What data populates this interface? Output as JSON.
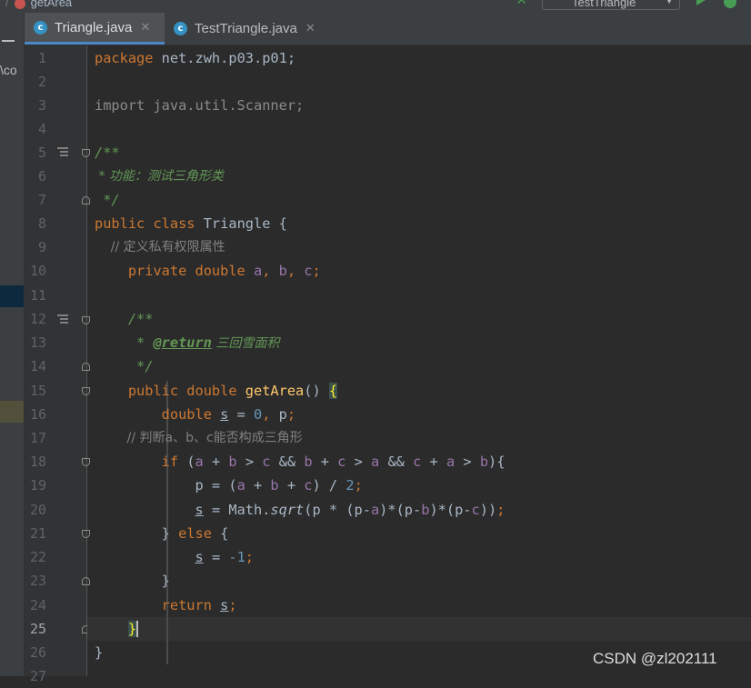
{
  "breadcrumb": {
    "method": "getArea"
  },
  "toolbar": {
    "run_config": "TestTriangle"
  },
  "project_panel": {
    "visible_text": "\\co"
  },
  "tabs": [
    {
      "label": "Triangle.java",
      "active": true,
      "icon": "class-icon"
    },
    {
      "label": "TestTriangle.java",
      "active": false,
      "icon": "class-icon"
    }
  ],
  "line_numbers": [
    "1",
    "2",
    "3",
    "4",
    "5",
    "6",
    "7",
    "8",
    "9",
    "10",
    "11",
    "12",
    "13",
    "14",
    "15",
    "16",
    "17",
    "18",
    "19",
    "20",
    "21",
    "22",
    "23",
    "24",
    "25",
    "26",
    "27"
  ],
  "current_line": "25",
  "code": {
    "l1_kw": "package",
    "l1_rest": " net.zwh.p03.p01;",
    "l3": "import java.util.Scanner;",
    "l5": "/**",
    "l6": " * 功能：测试三角形类",
    "l7": " */",
    "l8_kw": "public class",
    "l8_rest": " Triangle {",
    "l9": "    // 定义私有权限属性",
    "l10_kw": "    private double",
    "l10_a": "a",
    "l10_b": "b",
    "l10_c": "c",
    "l12": "    /**",
    "l13_star": "     * ",
    "l13_tag": "@return",
    "l13_text": " 三回雪面积",
    "l14": "     */",
    "l15_kw": "    public double",
    "l15_fn": "getArea",
    "l15_parens": "() ",
    "l15_brace": "{",
    "l16_kw": "        double",
    "l16_s": "s",
    "l16_zero": "0",
    "l16_p": " p",
    "l17": "        // 判断a、b、c能否构成三角形",
    "l18_kw": "        if",
    "l19_two": "2",
    "l20_s": "s",
    "l20_sqrt": "sqrt",
    "l21_close": "        } ",
    "l21_kw": "else",
    "l21_open": " {",
    "l22_s": "s",
    "l22_num": "-1",
    "l23": "        }",
    "l24_kw": "        return",
    "l24_s": "s",
    "l25_brace": "}",
    "l26": "}"
  },
  "watermark": "CSDN @zl202111"
}
